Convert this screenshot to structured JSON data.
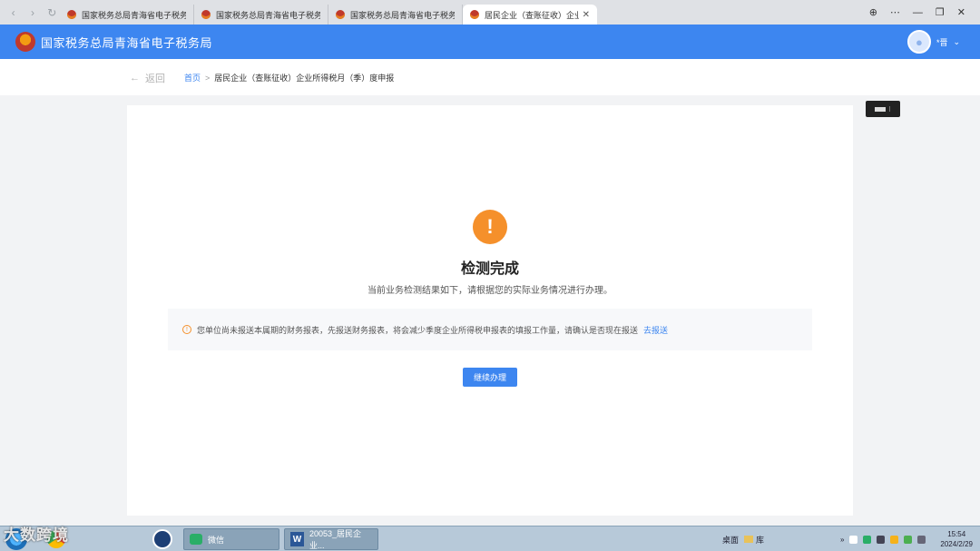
{
  "browser": {
    "tabs": [
      {
        "label": "国家税务总局青海省电子税务局",
        "active": false
      },
      {
        "label": "国家税务总局青海省电子税务局",
        "active": false
      },
      {
        "label": "国家税务总局青海省电子税务局",
        "active": false
      },
      {
        "label": "居民企业（查账征收）企业所",
        "active": true
      }
    ],
    "close_glyph": "✕"
  },
  "header": {
    "title": "国家税务总局青海省电子税务局",
    "user_name": "*晋"
  },
  "breadcrumb": {
    "back_label": "返回",
    "home": "首页",
    "separator": ">",
    "current": "居民企业（查账征收）企业所得税月（季）度申报"
  },
  "main": {
    "status_title": "检测完成",
    "status_subtitle": "当前业务检测结果如下，请根据您的实际业务情况进行办理。",
    "notice_text": "您单位尚未报送本属期的财务报表，先报送财务报表，将会减少季度企业所得税申报表的填报工作量，请确认是否现在报送",
    "notice_link": "去报送",
    "continue_button": "继续办理"
  },
  "taskbar": {
    "watermark": "大数跨境",
    "items": [
      {
        "label": "微信"
      },
      {
        "label": "20053_居民企业..."
      }
    ],
    "desktop_label": "桌面",
    "library_label": "库",
    "time": "15:54",
    "date": "2024/2/29"
  },
  "colors": {
    "primary": "#3d86f0",
    "warning": "#f5902b"
  }
}
